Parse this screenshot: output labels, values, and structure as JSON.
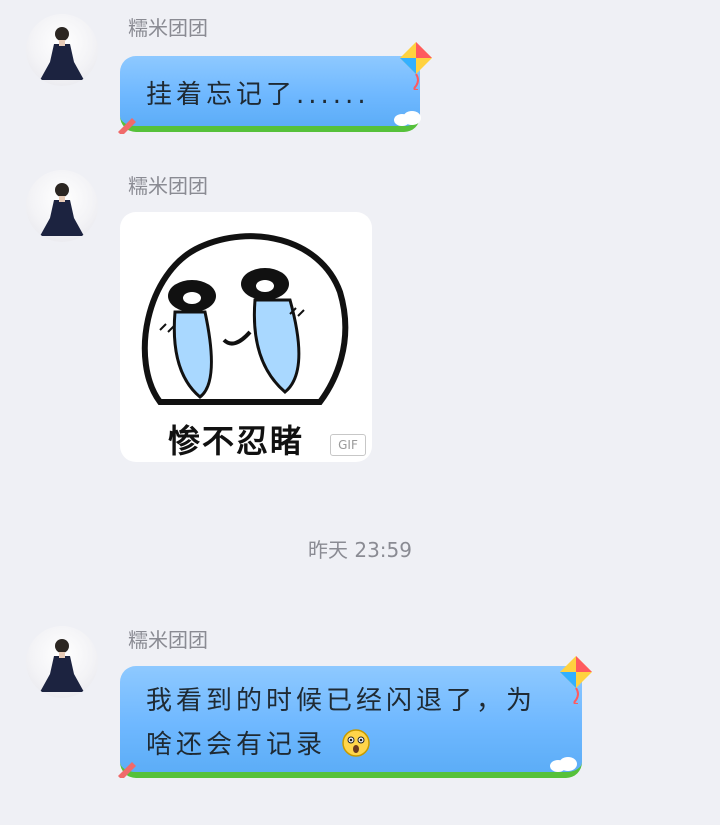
{
  "messages": [
    {
      "sender": "糯米团团",
      "text": "挂着忘记了......"
    },
    {
      "sender": "糯米团团",
      "sticker_caption": "惨不忍睹",
      "badge": "GIF"
    },
    {
      "sender": "糯米团团",
      "line1": "我看到的时候已经闪退了，为",
      "line2": "啥还会有记录"
    }
  ],
  "timestamp": "昨天 23:59",
  "icons": {
    "avatar": "user-avatar-icon",
    "kite": "kite-icon",
    "emoji": "surprised-face-icon"
  },
  "colors": {
    "background": "#eff0f5",
    "bubble": "#6fb8ff",
    "bubble_grass": "#56c13a",
    "sender_text": "#8a8b93"
  }
}
